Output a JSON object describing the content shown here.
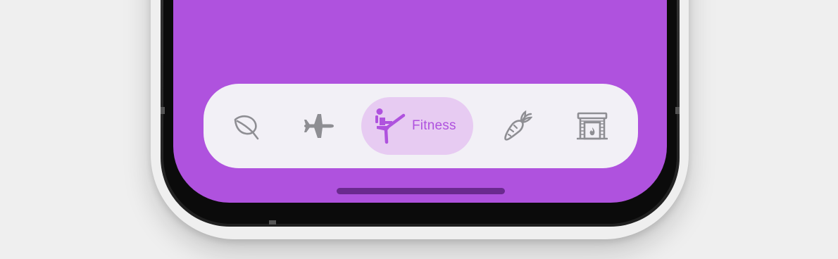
{
  "colors": {
    "accent": "#af52de",
    "screen_background": "#af52de",
    "tab_bar_background": "#f2f0f6",
    "selected_pill_background": "#e7cbf2",
    "inactive_icon": "#8e8e93",
    "home_indicator": "#6a2a8e",
    "phone_frame": "#0b0b0b",
    "page_background": "#efefef"
  },
  "tab_bar": {
    "selected_index": 2,
    "tabs": [
      {
        "icon": "leaf-icon",
        "label": "",
        "selected": false
      },
      {
        "icon": "airplane-icon",
        "label": "",
        "selected": false
      },
      {
        "icon": "figure-kickboxing-icon",
        "label": "Fitness",
        "selected": true
      },
      {
        "icon": "carrot-icon",
        "label": "",
        "selected": false
      },
      {
        "icon": "fireplace-icon",
        "label": "",
        "selected": false
      }
    ]
  }
}
